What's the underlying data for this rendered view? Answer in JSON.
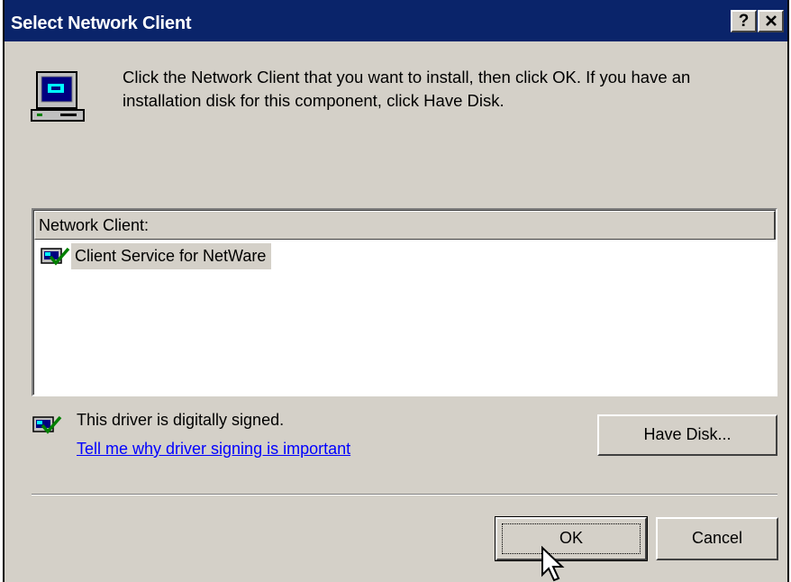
{
  "window": {
    "title": "Select Network Client",
    "help_label": "?",
    "close_label": "✕"
  },
  "instructions": "Click the Network Client that you want to install, then click OK. If you have an installation disk for this component, click Have Disk.",
  "list": {
    "header": "Network Client:",
    "items": [
      {
        "label": "Client Service for NetWare",
        "selected": true,
        "icon": "network-client-icon"
      }
    ]
  },
  "signing": {
    "status": "This driver is digitally signed.",
    "link": "Tell me why driver signing is important",
    "icon": "driver-signed-icon"
  },
  "buttons": {
    "have_disk": "Have Disk...",
    "ok": "OK",
    "cancel": "Cancel"
  },
  "colors": {
    "titlebar": "#0a246a",
    "dialog_face": "#d4d0c8",
    "link": "#0000ff"
  }
}
